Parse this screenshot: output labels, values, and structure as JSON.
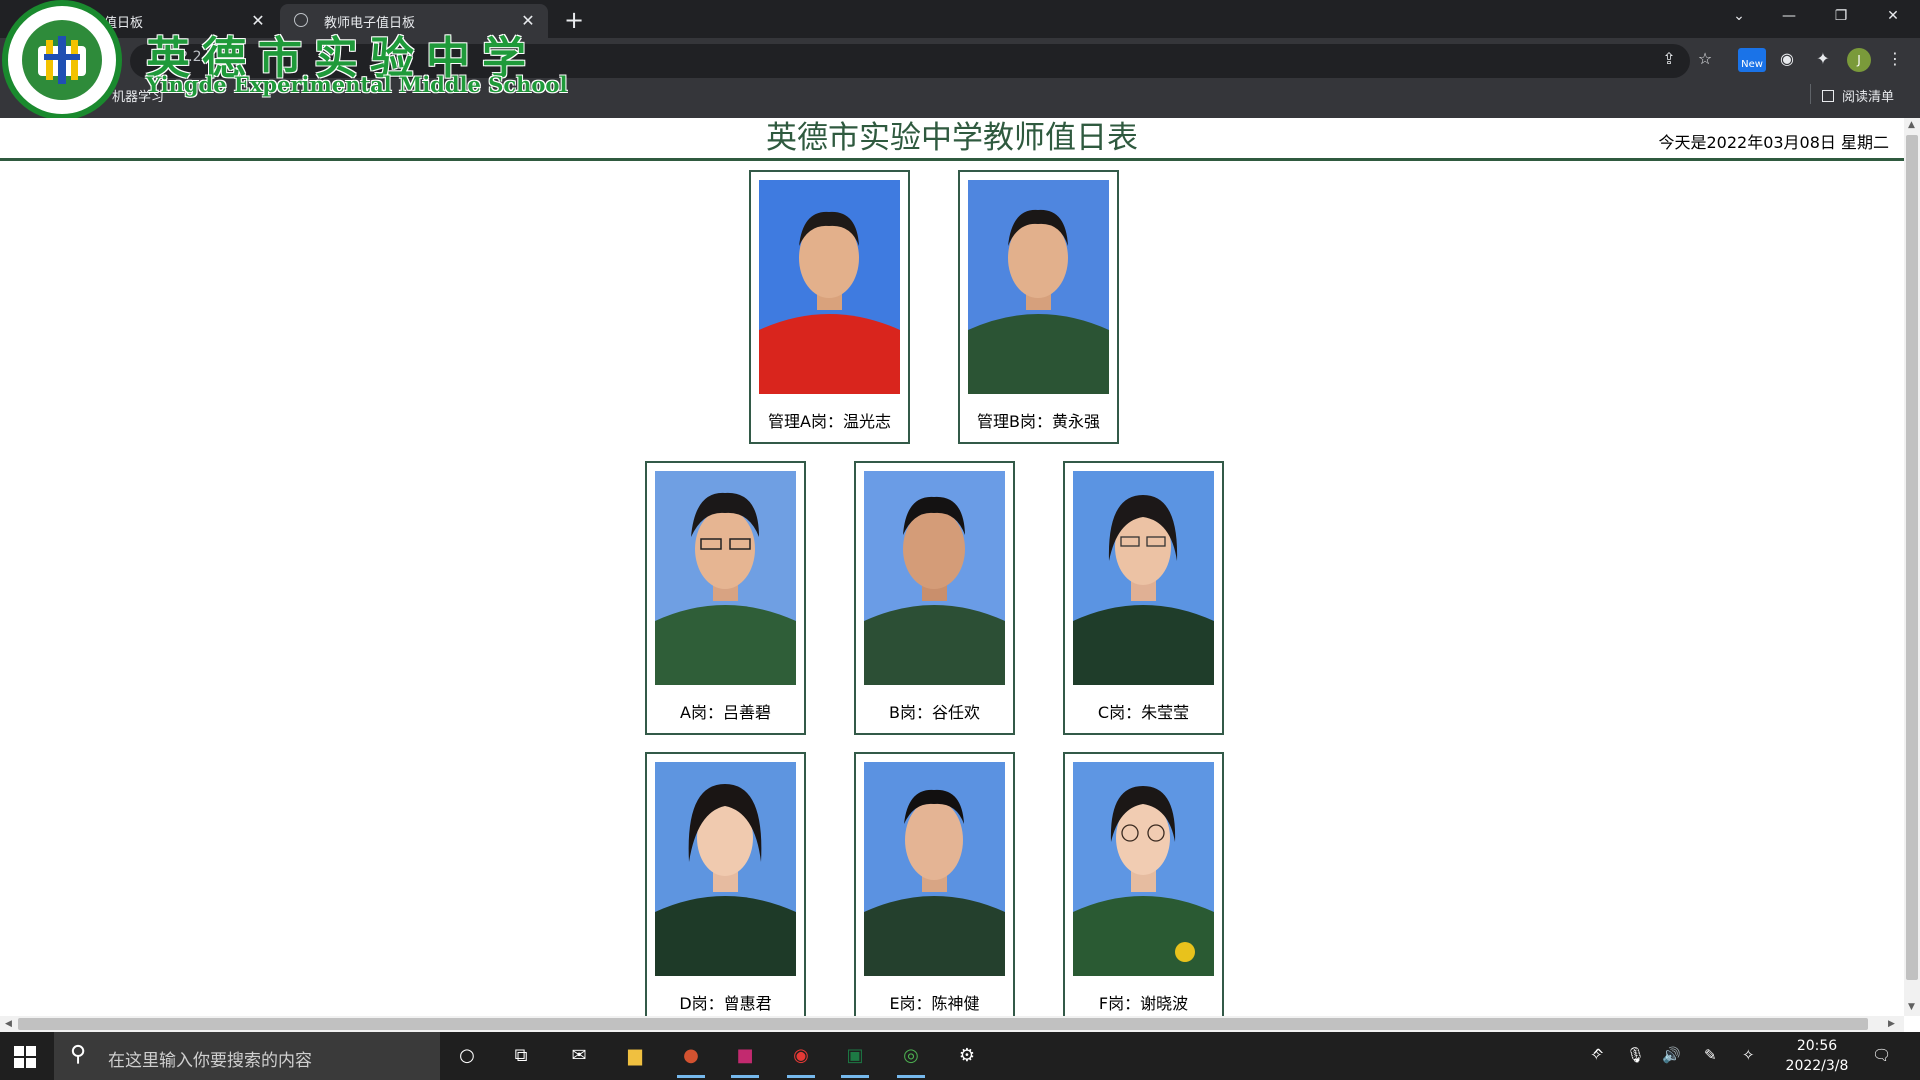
{
  "browser": {
    "tabs": [
      {
        "title": "值日板",
        "active": false
      },
      {
        "title": "教师电子值日板",
        "active": true
      }
    ],
    "address_fragment": "▲全 2.2 72",
    "bookmark": "机器学习",
    "reading_list": "阅读清单",
    "new_badge": "New",
    "profile_initial": "J"
  },
  "school": {
    "name_cn": "英德市实验中学",
    "name_en": "Yingde Experimental Middle School"
  },
  "page": {
    "title": "英德市实验中学教师值日表",
    "date": "今天是2022年03月08日 星期二"
  },
  "duty": [
    {
      "label": "管理A岗：温光志",
      "shirt": "#d9251d",
      "bg": "#3f7be0"
    },
    {
      "label": "管理B岗：黄永强",
      "shirt": "#2b5434",
      "bg": "#4f86df"
    },
    {
      "label": "A岗：吕善碧",
      "shirt": "#2f5e38",
      "bg": "#6f9fe3"
    },
    {
      "label": "B岗：谷任欢",
      "shirt": "#2c4f35",
      "bg": "#6a9ce6"
    },
    {
      "label": "C岗：朱莹莹",
      "shirt": "#1f3d2a",
      "bg": "#5b94e2"
    },
    {
      "label": "D岗：曾惠君",
      "shirt": "#1e3a28",
      "bg": "#5e95e0"
    },
    {
      "label": "E岗：陈神健",
      "shirt": "#24402d",
      "bg": "#5b92e1"
    },
    {
      "label": "F岗：谢晓波",
      "shirt": "#2a5a33",
      "bg": "#5e96e3"
    }
  ],
  "taskbar": {
    "search_placeholder": "在这里输入你要搜索的内容",
    "time": "20:56",
    "date": "2022/3/8"
  },
  "colors": {
    "brand_green": "#1f9a3a",
    "border": "#335a48",
    "title": "#2f5a3f"
  }
}
